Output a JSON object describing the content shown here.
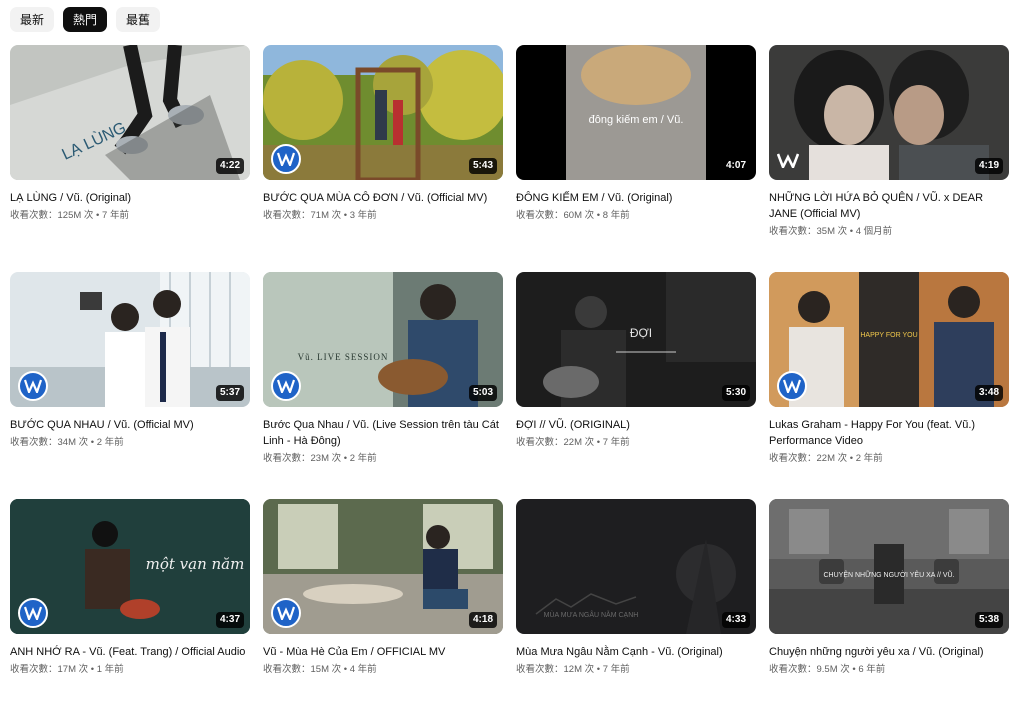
{
  "chips": [
    {
      "label": "最新",
      "active": false
    },
    {
      "label": "熱門",
      "active": true
    },
    {
      "label": "最舊",
      "active": false
    }
  ],
  "videos": [
    {
      "title": "LẠ LÙNG / Vũ. (Original)",
      "views": "收看次數：125M 次",
      "age": "7 年前",
      "duration": "4:22",
      "thumb_text": "LẠ LÙNG",
      "logo": "none"
    },
    {
      "title": "BƯỚC QUA MÙA CÔ ĐƠN / Vũ. (Official MV)",
      "views": "收看次數：71M 次",
      "age": "3 年前",
      "duration": "5:43",
      "thumb_text": "",
      "logo": "warner-circle"
    },
    {
      "title": "ĐÔNG KIẾM EM / Vũ. (Original)",
      "views": "收看次數：60M 次",
      "age": "8 年前",
      "duration": "4:07",
      "thumb_text": "đông kiếm em / Vũ.",
      "logo": "none"
    },
    {
      "title": "NHỮNG LỜI HỨA BỎ QUÊN / VŨ. x DEAR JANE (Official MV)",
      "views": "收看次數：35M 次",
      "age": "4 個月前",
      "duration": "4:19",
      "thumb_text": "",
      "logo": "warner-plain"
    },
    {
      "title": "BƯỚC QUA NHAU / Vũ. (Official MV)",
      "views": "收看次數：34M 次",
      "age": "2 年前",
      "duration": "5:37",
      "thumb_text": "",
      "logo": "warner-circle"
    },
    {
      "title": "Bước Qua Nhau / Vũ. (Live Session trên tàu Cát Linh - Hà Đông)",
      "views": "收看次數：23M 次",
      "age": "2 年前",
      "duration": "5:03",
      "thumb_text": "Vũ. LIVE SESSION",
      "logo": "warner-circle"
    },
    {
      "title": "ĐỢI // VŨ. (ORIGINAL)",
      "views": "收看次數：22M 次",
      "age": "7 年前",
      "duration": "5:30",
      "thumb_text": "ĐỢI",
      "logo": "none"
    },
    {
      "title": "Lukas Graham - Happy For You (feat. Vũ.) Performance Video",
      "views": "收看次數：22M 次",
      "age": "2 年前",
      "duration": "3:48",
      "thumb_text": "HAPPY FOR YOU",
      "logo": "warner-circle"
    },
    {
      "title": "ANH NHỚ RA - Vũ. (Feat. Trang) / Official Audio",
      "views": "收看次數：17M 次",
      "age": "1 年前",
      "duration": "4:37",
      "thumb_text": "một vạn năm",
      "logo": "warner-circle"
    },
    {
      "title": "Vũ - Mùa Hè Của Em / OFFICIAL MV",
      "views": "收看次數：15M 次",
      "age": "4 年前",
      "duration": "4:18",
      "thumb_text": "",
      "logo": "warner-circle"
    },
    {
      "title": "Mùa Mưa Ngâu Nằm Cạnh - Vũ. (Original)",
      "views": "收看次數：12M 次",
      "age": "7 年前",
      "duration": "4:33",
      "thumb_text": "MÙA MƯA NGÂU NẰM CẠNH",
      "logo": "none"
    },
    {
      "title": "Chuyện những người yêu xa / Vũ. (Original)",
      "views": "收看次數：9.5M 次",
      "age": "6 年前",
      "duration": "5:38",
      "thumb_text": "CHUYỆN NHỮNG NGƯỜI YÊU XA // VŨ.",
      "logo": "none"
    }
  ],
  "colors": {
    "chip_active": "#0f0f0f",
    "chip_bg": "#f2f2f2",
    "meta": "#606060",
    "warner_blue": "#1f63c7"
  }
}
